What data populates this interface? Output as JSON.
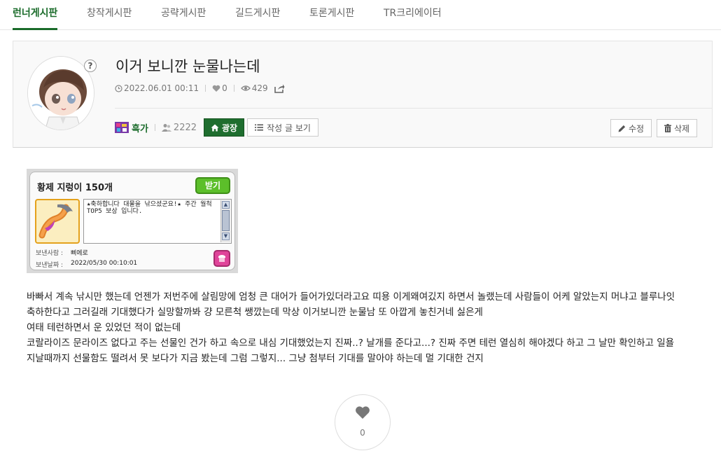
{
  "tabs": [
    {
      "label": "런너게시판",
      "active": true
    },
    {
      "label": "창작게시판"
    },
    {
      "label": "공략게시판"
    },
    {
      "label": "길드게시판"
    },
    {
      "label": "토론게시판"
    },
    {
      "label": "TR크리에이터"
    }
  ],
  "post": {
    "title": "이거 보니깐 눈물나는데",
    "datetime": "2022.06.01 00:11",
    "likes": "0",
    "views": "429",
    "author": "흑가",
    "level": "2222",
    "plaza_label": "광장",
    "my_posts_label": "작성 글 보기",
    "edit_label": "수정",
    "delete_label": "삭제",
    "help_label": "?"
  },
  "ingame_mail": {
    "title": "황제 지렁이 150개",
    "receive_label": "받기",
    "message": "★축하합니다 대물을 낚으셨군요!★ 주간 월척 TOP5 보상 입니다.",
    "sender_label": "보낸사람 :",
    "sender": "삐에로",
    "date_label": "보낸날짜 :",
    "date": "2022/05/30 00:10:01"
  },
  "body": {
    "lines": [
      "바빠서 계속 낚시만 했는데 언젠가 저번주에 살림망에 엄청 큰 대어가 들어가있더라고요 띠용 이게왜여깄지 하면서 놀랬는데 사람들이 어케 알았는지 머냐고 블루나잇",
      "축하한다고 그러길래 기대했다가 실망할까봐 걍 모른척 쌩깠는데 막상 이거보니깐 눈물남 또 아깝게 놓친거네 싫은게",
      "여태 테런하면서 운 있었던 적이 없는데",
      "코랄라이즈 문라이즈 없다고 주는 선물인 건가 하고 속으로 내심 기대했었는지 진짜..? 날개를 준다고...? 진짜 주면 테런 열심히 해야겠다 하고 그 날만 확인하고 일욜",
      "지날때까지 선물함도 떨려서 못 보다가 지금 봤는데 그럼 그렇지... 그냥 첨부터 기대를 말아야 하는데 멀 기대한 건지"
    ]
  },
  "like_button": {
    "count": "0"
  },
  "colors": {
    "accent": "#1a6b2a",
    "plaza": "#1f6e2f"
  }
}
